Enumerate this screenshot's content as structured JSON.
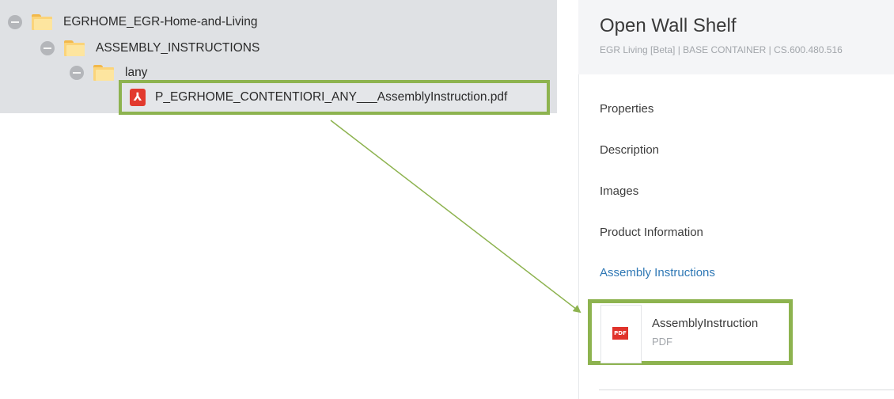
{
  "tree": {
    "root": {
      "label": "EGRHOME_EGR-Home-and-Living",
      "icon": "folder-icon"
    },
    "child": {
      "label": "ASSEMBLY_INSTRUCTIONS",
      "icon": "folder-icon"
    },
    "grandchild": {
      "label": "lany",
      "icon": "folder-icon"
    },
    "file": {
      "label": "P_EGRHOME_CONTENTIORI_ANY___AssemblyInstruction.pdf",
      "icon": "pdf-icon",
      "icon_glyph": "⅄"
    }
  },
  "panel": {
    "title": "Open Wall Shelf",
    "subtitle": "EGR Living [Beta] | BASE CONTAINER | CS.600.480.516",
    "sections": [
      {
        "label": "Properties"
      },
      {
        "label": "Description"
      },
      {
        "label": "Images"
      },
      {
        "label": "Product Information"
      },
      {
        "label": "Assembly Instructions",
        "active": true
      }
    ],
    "asset": {
      "name": "AssemblyInstruction",
      "type": "PDF",
      "thumb_label": "PDF"
    }
  },
  "colors": {
    "highlight_border": "#8db34f",
    "arrow": "#8db34f",
    "active_section": "#2f78b5",
    "pdf_red": "#e23a2e"
  }
}
